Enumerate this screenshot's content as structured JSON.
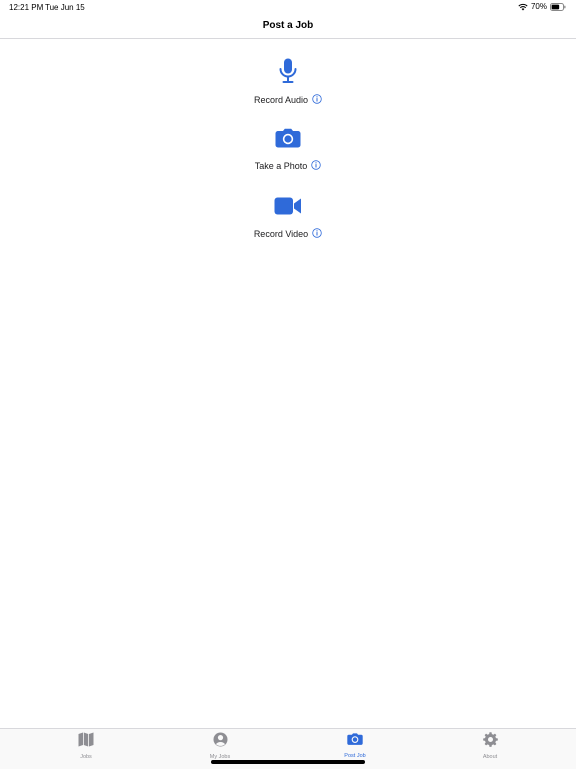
{
  "status_bar": {
    "time": "12:21 PM",
    "date": "Tue Jun 15",
    "battery_text": "70%",
    "battery_level": 0.7
  },
  "nav": {
    "title": "Post a Job"
  },
  "actions": [
    {
      "label": "Record Audio",
      "icon": "microphone-icon"
    },
    {
      "label": "Take a Photo",
      "icon": "camera-icon"
    },
    {
      "label": "Record Video",
      "icon": "video-camera-icon"
    }
  ],
  "tabs": [
    {
      "label": "Jobs",
      "icon": "map-icon",
      "active": false
    },
    {
      "label": "My Jobs",
      "icon": "person-icon",
      "active": false
    },
    {
      "label": "Post Job",
      "icon": "camera-icon",
      "active": true
    },
    {
      "label": "About",
      "icon": "gear-icon",
      "active": false
    }
  ],
  "colors": {
    "accent": "#2f6ad9",
    "inactive": "#8e8e93"
  }
}
